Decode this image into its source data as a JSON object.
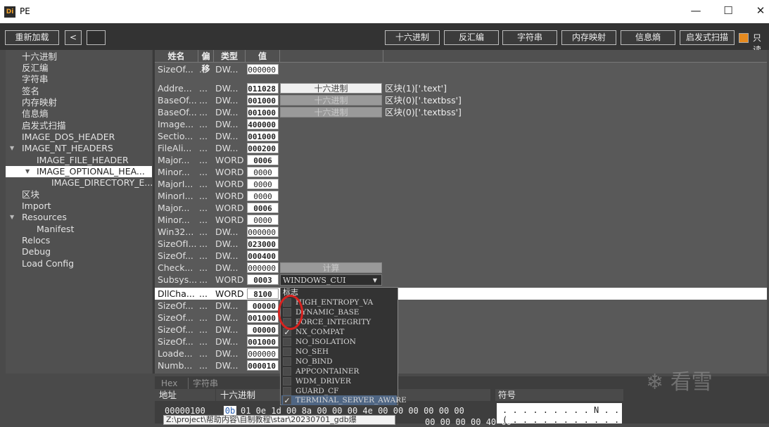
{
  "title": "PE",
  "logo_text": "Di",
  "window_buttons": {
    "min": "—",
    "max": "☐",
    "close": "✕"
  },
  "toolbar": {
    "reload": "重新加载",
    "back": "<",
    "hex": "十六进制",
    "disasm": "反汇编",
    "strings": "字符串",
    "memmap": "内存映射",
    "entropy": "信息熵",
    "heuristic": "启发式扫描",
    "readonly": "只读"
  },
  "sidebar": [
    {
      "label": "十六进制",
      "indent": 0
    },
    {
      "label": "反汇编",
      "indent": 0
    },
    {
      "label": "字符串",
      "indent": 0
    },
    {
      "label": "签名",
      "indent": 0
    },
    {
      "label": "内存映射",
      "indent": 0
    },
    {
      "label": "信息熵",
      "indent": 0
    },
    {
      "label": "启发式扫描",
      "indent": 0
    },
    {
      "label": "IMAGE_DOS_HEADER",
      "indent": 0
    },
    {
      "label": "IMAGE_NT_HEADERS",
      "indent": 0
    },
    {
      "label": "IMAGE_FILE_HEADER",
      "indent": 1
    },
    {
      "label": "IMAGE_OPTIONAL_HEA...",
      "indent": 1
    },
    {
      "label": "IMAGE_DIRECTORY_E...",
      "indent": 2
    },
    {
      "label": "区块",
      "indent": 0
    },
    {
      "label": "Import",
      "indent": 0
    },
    {
      "label": "Resources",
      "indent": 0
    },
    {
      "label": "Manifest",
      "indent": 1
    },
    {
      "label": "Relocs",
      "indent": 0
    },
    {
      "label": "Debug",
      "indent": 0
    },
    {
      "label": "Load Config",
      "indent": 0
    }
  ],
  "columns": {
    "name": "姓名",
    "offset": "偏移",
    "type": "类型",
    "value": "值"
  },
  "rows": [
    {
      "name": "SizeOf...",
      "offset": "...",
      "type": "DW...",
      "value": "000000"
    },
    {
      "name": "Addre...",
      "offset": "...",
      "type": "DW...",
      "value": "011028",
      "button": "十六进制",
      "note": "区块(1)['.text']"
    },
    {
      "name": "BaseOf...",
      "offset": "...",
      "type": "DW...",
      "value": "001000",
      "button": "十六进制",
      "note": "区块(0)['.textbss']"
    },
    {
      "name": "BaseOf...",
      "offset": "...",
      "type": "DW...",
      "value": "001000",
      "button": "十六进制",
      "note": "区块(0)['.textbss']"
    },
    {
      "name": "Image...",
      "offset": "...",
      "type": "DW...",
      "value": "400000"
    },
    {
      "name": "Sectio...",
      "offset": "...",
      "type": "DW...",
      "value": "001000"
    },
    {
      "name": "FileAli...",
      "offset": "...",
      "type": "DW...",
      "value": "000200"
    },
    {
      "name": "Major...",
      "offset": "...",
      "type": "WORD",
      "value": "0006"
    },
    {
      "name": "Minor...",
      "offset": "...",
      "type": "WORD",
      "value": "0000"
    },
    {
      "name": "MajorI...",
      "offset": "...",
      "type": "WORD",
      "value": "0000"
    },
    {
      "name": "MinorI...",
      "offset": "...",
      "type": "WORD",
      "value": "0000"
    },
    {
      "name": "Major...",
      "offset": "...",
      "type": "WORD",
      "value": "0006"
    },
    {
      "name": "Minor...",
      "offset": "...",
      "type": "WORD",
      "value": "0000"
    },
    {
      "name": "Win32...",
      "offset": "...",
      "type": "DW...",
      "value": "000000"
    },
    {
      "name": "SizeOfI...",
      "offset": "...",
      "type": "DW...",
      "value": "023000"
    },
    {
      "name": "SizeOf...",
      "offset": "...",
      "type": "DW...",
      "value": "000400"
    },
    {
      "name": "Check...",
      "offset": "...",
      "type": "DW...",
      "value": "000000",
      "button": "计算"
    },
    {
      "name": "Subsys...",
      "offset": "...",
      "type": "WORD",
      "value": "0003",
      "combo": "WINDOWS_CUI"
    },
    {
      "name": "DllCha...",
      "offset": "...",
      "type": "WORD",
      "value": "8100"
    },
    {
      "name": "SizeOf...",
      "offset": "...",
      "type": "DW...",
      "value": "00000"
    },
    {
      "name": "SizeOf...",
      "offset": "...",
      "type": "DW...",
      "value": "001000"
    },
    {
      "name": "SizeOf...",
      "offset": "...",
      "type": "DW...",
      "value": "00000"
    },
    {
      "name": "SizeOf...",
      "offset": "...",
      "type": "DW...",
      "value": "001000"
    },
    {
      "name": "Loade...",
      "offset": "...",
      "type": "DW...",
      "value": "000000"
    },
    {
      "name": "Numb...",
      "offset": "...",
      "type": "DW...",
      "value": "000010"
    }
  ],
  "dropdown": {
    "header": "标志",
    "items": [
      {
        "label": "HIGH_ENTROPY_VA",
        "checked": false
      },
      {
        "label": "DYNAMIC_BASE",
        "checked": false
      },
      {
        "label": "FORCE_INTEGRITY",
        "checked": false
      },
      {
        "label": "NX_COMPAT",
        "checked": true
      },
      {
        "label": "NO_ISOLATION",
        "checked": false
      },
      {
        "label": "NO_SEH",
        "checked": false
      },
      {
        "label": "NO_BIND",
        "checked": false
      },
      {
        "label": "APPCONTAINER",
        "checked": false
      },
      {
        "label": "WDM_DRIVER",
        "checked": false
      },
      {
        "label": "GUARD_CF",
        "checked": false
      },
      {
        "label": "TERMINAL_SERVER_AWARE",
        "checked": true
      }
    ]
  },
  "bottom": {
    "tabs": [
      "Hex",
      "字符串"
    ],
    "col_address": "地址",
    "col_hex": "十六进制",
    "col_symbols": "符号",
    "address": "00000100",
    "hex_first": "0b",
    "hex_rest": "01 0e 1d 00 8a 00 00 00 4e 00 00 00 00 00 00",
    "ascii": ". . . . . . . . . N . . . . . .",
    "tooltip": "Z:\\project\\帮助内容\\自制教程\\star\\20230701_gdb爆",
    "partial_hex": "00 00 00 00 40 00",
    "partial_ascii": "( . . . . . . . . . . . @ ."
  },
  "watermark": "看雪"
}
